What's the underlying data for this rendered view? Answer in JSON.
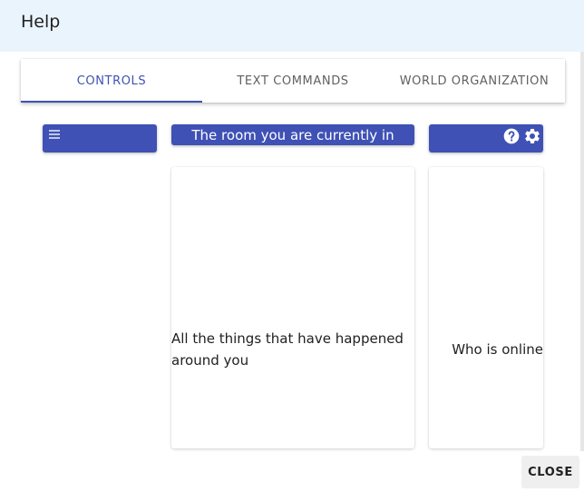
{
  "dialog": {
    "title": "Help",
    "close_label": "CLOSE"
  },
  "tabs": [
    {
      "label": "CONTROLS",
      "active": true
    },
    {
      "label": "TEXT COMMANDS",
      "active": false
    },
    {
      "label": "WORLD ORGANIZATION",
      "active": false
    }
  ],
  "preview": {
    "left_bar_icon": "menu-icon",
    "mid_bar_text": "The room you are currently in",
    "right_bar_icons": [
      "help-icon",
      "gear-icon"
    ],
    "mid_card_text": "All the things that have happened around you",
    "right_card_text": "Who is online"
  },
  "colors": {
    "accent": "#3f51b5",
    "header_bg": "#eaf4fd"
  }
}
